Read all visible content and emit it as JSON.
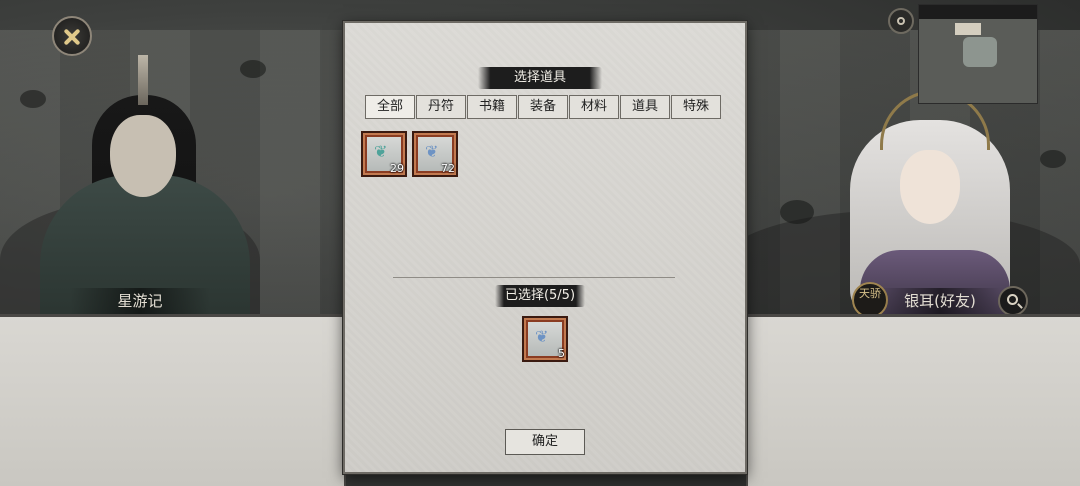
{
  "dialog": {
    "title": "选择道具",
    "tabs": [
      {
        "label": "全部",
        "active": true
      },
      {
        "label": "丹符",
        "active": false
      },
      {
        "label": "书籍",
        "active": false
      },
      {
        "label": "装备",
        "active": false
      },
      {
        "label": "材料",
        "active": false
      },
      {
        "label": "道具",
        "active": false
      },
      {
        "label": "特殊",
        "active": false
      }
    ],
    "items": [
      {
        "icon": "green-herb-icon",
        "count": "29",
        "color": "#4fa39a"
      },
      {
        "icon": "blue-herb-icon",
        "count": "72",
        "color": "#6d93c4"
      }
    ],
    "selected_title": "已选择(5/5)",
    "selected_items": [
      {
        "icon": "blue-herb-icon",
        "count": "5",
        "color": "#6d93c4"
      }
    ],
    "confirm_label": "确定"
  },
  "left_character": {
    "name": "星游记"
  },
  "right_character": {
    "name": "银耳(好友)",
    "title_badge": "天骄"
  },
  "colors": {
    "dialog_bg": "#d6d4cf",
    "item_frame": "#8a3c22",
    "title_ribbon": "#1d1d1d"
  }
}
